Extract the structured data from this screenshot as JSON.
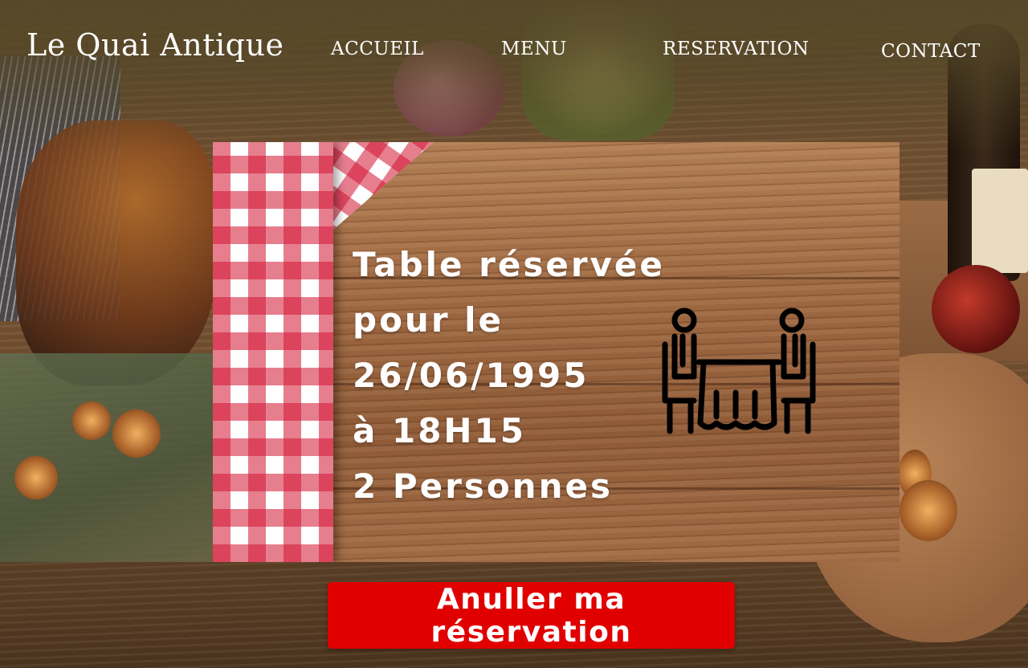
{
  "header": {
    "logo": "Le Quai Antique",
    "nav": [
      {
        "label": "ACCUEIL"
      },
      {
        "label": "MENU"
      },
      {
        "label": "RESERVATION"
      },
      {
        "label": "CONTACT"
      }
    ]
  },
  "reservation": {
    "lines": [
      "Table réservée",
      "pour le",
      "26/06/1995",
      "à 18H15",
      "2 Personnes"
    ],
    "icon": "table-for-two-icon"
  },
  "actions": {
    "cancel_label": "Anuller ma réservation"
  },
  "colors": {
    "accent": "#e00000",
    "text": "#ffffff",
    "gingham_red": "#d2143a"
  }
}
